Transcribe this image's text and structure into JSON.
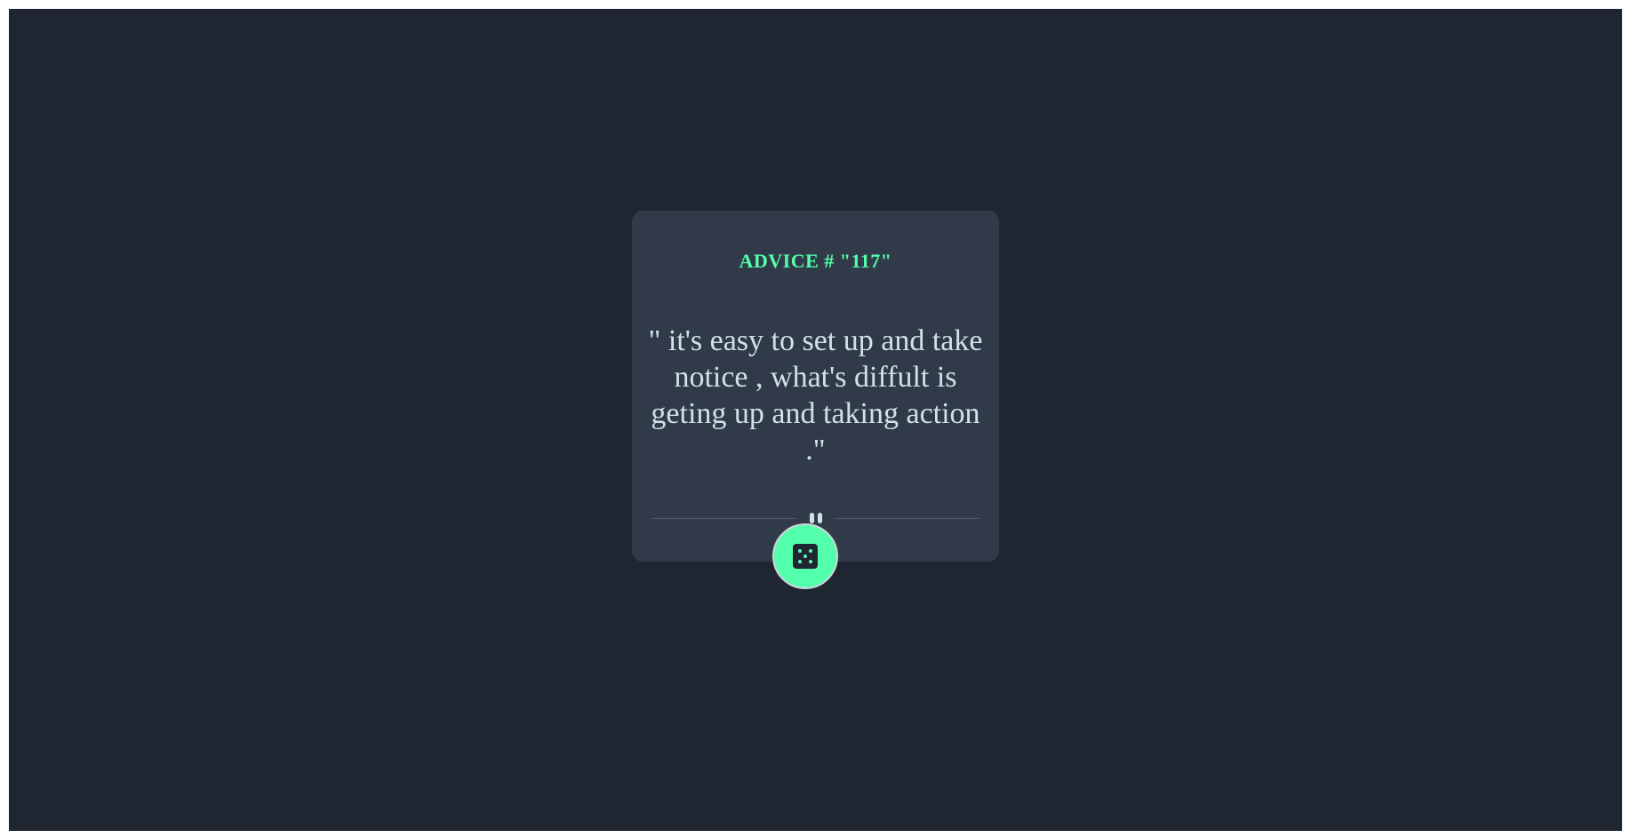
{
  "advice": {
    "id_label": "ADVICE # \"117\"",
    "text": "\" it's easy to set up and take notice , what's diffult is geting up and taking action .\""
  },
  "divider": {
    "icon": "pause-icon"
  },
  "button": {
    "icon": "dice-icon"
  },
  "colors": {
    "background": "#1f2632",
    "card": "#313a48",
    "accent": "#53ffaa",
    "text": "#cee3e9",
    "divider": "#4f5b6a"
  }
}
